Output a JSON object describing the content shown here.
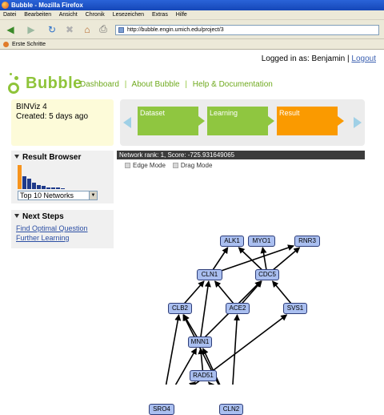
{
  "window": {
    "title": "Bubble - Mozilla Firefox"
  },
  "menubar": [
    "Datei",
    "Bearbeiten",
    "Ansicht",
    "Chronik",
    "Lesezeichen",
    "Extras",
    "Hilfe"
  ],
  "toolbar": {
    "url": "http://bubble.engin.umich.edu/project/3"
  },
  "bookmarks": {
    "first_steps": "Erste Schritte"
  },
  "header": {
    "logged_in": "Logged in as: Benjamin",
    "separator": "|",
    "logout": "Logout",
    "logo_text": "Bubble",
    "nav": [
      "Dashboard",
      "About Bubble",
      "Help & Documentation"
    ]
  },
  "project": {
    "name": "BINViz 4",
    "created": "Created: 5 days ago"
  },
  "wizard": {
    "steps": [
      "Dataset",
      "Learning",
      "Result"
    ],
    "active_step": "Result"
  },
  "result_browser": {
    "title": "Result Browser",
    "histogram_relative_heights": [
      1.0,
      0.52,
      0.42,
      0.25,
      0.18,
      0.12,
      0.08,
      0.06,
      0.05,
      0.04
    ],
    "histogram_colors": {
      "first": "#f7941d",
      "rest": "#1f3a8a"
    },
    "select_value": "Top 10 Networks"
  },
  "next_steps": {
    "title": "Next Steps",
    "links": [
      "Find Optimal Question",
      "Further Learning"
    ]
  },
  "network": {
    "header": "Network rank: 1, Score: -725.931649065",
    "modes": [
      "Edge Mode",
      "Drag Mode"
    ],
    "nodes": [
      "ALK1",
      "MYO1",
      "RNR3",
      "CLN1",
      "CDC5",
      "CLB2",
      "ACE2",
      "SVS1",
      "MNN1",
      "RAD51",
      "SRO4",
      "CLN2"
    ],
    "edges": [
      [
        "CLN1",
        "ALK1"
      ],
      [
        "CDC5",
        "ALK1"
      ],
      [
        "CDC5",
        "MYO1"
      ],
      [
        "CDC5",
        "RNR3"
      ],
      [
        "CLN1",
        "RNR3"
      ],
      [
        "CLB2",
        "CLN1"
      ],
      [
        "ACE2",
        "CLN1"
      ],
      [
        "ACE2",
        "CDC5"
      ],
      [
        "MNN1",
        "CLN1"
      ],
      [
        "MNN1",
        "CDC5"
      ],
      [
        "SVS1",
        "CDC5"
      ],
      [
        "MNN1",
        "CLB2"
      ],
      [
        "SRO4",
        "CLB2"
      ],
      [
        "SRO4",
        "MNN1"
      ],
      [
        "SRO4",
        "RAD51"
      ],
      [
        "SRO4",
        "SVS1"
      ],
      [
        "CLN2",
        "RAD51"
      ],
      [
        "CLN2",
        "MNN1"
      ],
      [
        "CLN2",
        "ACE2"
      ],
      [
        "RAD51",
        "MNN1"
      ],
      [
        "CLN2",
        "CLB2"
      ]
    ],
    "node_color": "#aabff0",
    "edge_color": "#000000"
  }
}
